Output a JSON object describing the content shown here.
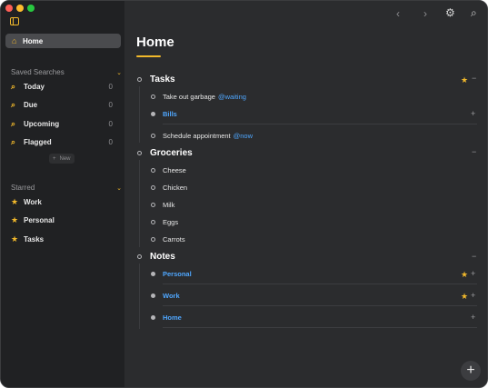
{
  "sidebar": {
    "home_label": "Home",
    "saved_searches": {
      "title": "Saved Searches",
      "items": [
        {
          "label": "Today",
          "count": "0"
        },
        {
          "label": "Due",
          "count": "0"
        },
        {
          "label": "Upcoming",
          "count": "0"
        },
        {
          "label": "Flagged",
          "count": "0"
        }
      ],
      "new_label": "New"
    },
    "starred": {
      "title": "Starred",
      "items": [
        {
          "label": "Work"
        },
        {
          "label": "Personal"
        },
        {
          "label": "Tasks"
        }
      ]
    }
  },
  "main": {
    "title": "Home",
    "groups": {
      "tasks": {
        "title": "Tasks",
        "items": [
          {
            "text": "Take out garbage",
            "tag": "@waiting"
          },
          {
            "text": "Bills"
          },
          {
            "text": "Schedule appointment",
            "tag": "@now"
          }
        ]
      },
      "groceries": {
        "title": "Groceries",
        "items": [
          "Cheese",
          "Chicken",
          "Milk",
          "Eggs",
          "Carrots"
        ]
      },
      "notes": {
        "title": "Notes",
        "items": [
          "Personal",
          "Work",
          "Home"
        ]
      }
    }
  },
  "colors": {
    "accent": "#f2b92b",
    "link": "#4fa7ff",
    "sidebar_bg": "#202123",
    "main_bg": "#2b2c2e"
  }
}
